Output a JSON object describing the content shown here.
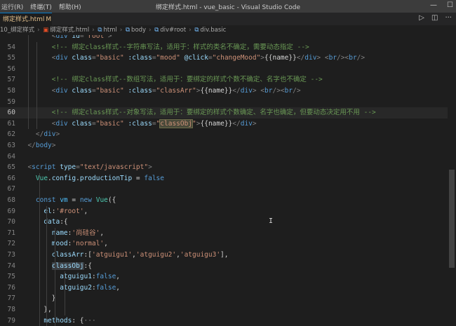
{
  "titlebar": {
    "menu": [
      "运行(R)",
      "终端(T)",
      "帮助(H)"
    ],
    "title": "绑定样式.html - vue_basic - Visual Studio Code"
  },
  "tab": {
    "label": "绑定样式.html",
    "modified": "M",
    "close": "×"
  },
  "breadcrumb": {
    "items": [
      "10_绑定样式",
      "绑定样式.html",
      "html",
      "body",
      "div#root",
      "div.basic"
    ]
  },
  "editor": {
    "current_line": 60,
    "lines": [
      {
        "n": "",
        "segs": [
          [
            "pun",
            "        <"
          ],
          [
            "tag",
            "div"
          ],
          [
            "att",
            " id"
          ],
          [
            "pun",
            "="
          ],
          [
            "str",
            "\"root\""
          ],
          [
            "pun",
            ">"
          ]
        ]
      },
      {
        "n": "54",
        "segs": [
          [
            "cmt",
            "        <!-- 绑定class样式--字符串写法，适用于：样式的类名不确定，需要动态指定 -->"
          ]
        ]
      },
      {
        "n": "55",
        "segs": [
          [
            "pun",
            "        <"
          ],
          [
            "tag",
            "div"
          ],
          [
            "att",
            " class"
          ],
          [
            "pun",
            "="
          ],
          [
            "str",
            "\"basic\""
          ],
          [
            "att",
            " :class"
          ],
          [
            "pun",
            "="
          ],
          [
            "str",
            "\"mood\""
          ],
          [
            "att",
            " @click"
          ],
          [
            "pun",
            "="
          ],
          [
            "str",
            "\"changeMood\""
          ],
          [
            "pun",
            ">"
          ],
          [
            "txt",
            "{{name}}"
          ],
          [
            "pun",
            "</"
          ],
          [
            "tag",
            "div"
          ],
          [
            "pun",
            "> <"
          ],
          [
            "tag",
            "br"
          ],
          [
            "pun",
            "/><"
          ],
          [
            "tag",
            "br"
          ],
          [
            "pun",
            "/>"
          ]
        ]
      },
      {
        "n": "56",
        "segs": []
      },
      {
        "n": "57",
        "segs": [
          [
            "cmt",
            "        <!-- 绑定class样式--数组写法，适用于：要绑定的样式个数不确定、名字也不确定 -->"
          ]
        ]
      },
      {
        "n": "58",
        "segs": [
          [
            "pun",
            "        <"
          ],
          [
            "tag",
            "div"
          ],
          [
            "att",
            " class"
          ],
          [
            "pun",
            "="
          ],
          [
            "str",
            "\"basic\""
          ],
          [
            "att",
            " :class"
          ],
          [
            "pun",
            "="
          ],
          [
            "str",
            "\"classArr\""
          ],
          [
            "pun",
            ">"
          ],
          [
            "txt",
            "{{name}}"
          ],
          [
            "pun",
            "</"
          ],
          [
            "tag",
            "div"
          ],
          [
            "pun",
            "> <"
          ],
          [
            "tag",
            "br"
          ],
          [
            "pun",
            "/><"
          ],
          [
            "tag",
            "br"
          ],
          [
            "pun",
            "/>"
          ]
        ]
      },
      {
        "n": "59",
        "segs": []
      },
      {
        "n": "60",
        "segs": [
          [
            "cmt",
            "        <!-- 绑定class样式--对象写法，适用于：要绑定的样式个数确定、名字也确定，但要动态决定用不用 -->"
          ]
        ]
      },
      {
        "n": "61",
        "segs": [
          [
            "pun",
            "        <"
          ],
          [
            "tag",
            "div"
          ],
          [
            "att",
            " class"
          ],
          [
            "pun",
            "="
          ],
          [
            "str",
            "\"basic\""
          ],
          [
            "att",
            " :class"
          ],
          [
            "pun",
            "="
          ],
          [
            "str",
            "\""
          ],
          [
            "hlstr",
            "classObj"
          ],
          [
            "str",
            "\""
          ],
          [
            "pun",
            ">"
          ],
          [
            "txt",
            "{{name}}"
          ],
          [
            "pun",
            "</"
          ],
          [
            "tag",
            "div"
          ],
          [
            "pun",
            ">"
          ]
        ]
      },
      {
        "n": "62",
        "segs": [
          [
            "pun",
            "    </"
          ],
          [
            "tag",
            "div"
          ],
          [
            "pun",
            ">"
          ]
        ]
      },
      {
        "n": "63",
        "segs": [
          [
            "pun",
            "  </"
          ],
          [
            "tag",
            "body"
          ],
          [
            "pun",
            ">"
          ]
        ]
      },
      {
        "n": "64",
        "segs": []
      },
      {
        "n": "65",
        "segs": [
          [
            "pun",
            "  <"
          ],
          [
            "tag",
            "script"
          ],
          [
            "att",
            " type"
          ],
          [
            "pun",
            "="
          ],
          [
            "str",
            "\"text/javascript\""
          ],
          [
            "pun",
            ">"
          ]
        ]
      },
      {
        "n": "66",
        "segs": [
          [
            "cls",
            "    Vue"
          ],
          [
            "txt",
            "."
          ],
          [
            "prop",
            "config"
          ],
          [
            "txt",
            "."
          ],
          [
            "prop",
            "productionTip"
          ],
          [
            "txt",
            " = "
          ],
          [
            "kw",
            "false"
          ]
        ]
      },
      {
        "n": "67",
        "segs": []
      },
      {
        "n": "68",
        "segs": [
          [
            "kw",
            "    const"
          ],
          [
            "var",
            " vm"
          ],
          [
            "txt",
            " = "
          ],
          [
            "kw",
            "new"
          ],
          [
            "cls",
            " Vue"
          ],
          [
            "txt",
            "({"
          ]
        ]
      },
      {
        "n": "69",
        "segs": [
          [
            "prop",
            "      el"
          ],
          [
            "txt",
            ":"
          ],
          [
            "str",
            "'#root'"
          ],
          [
            "txt",
            ","
          ]
        ]
      },
      {
        "n": "70",
        "segs": [
          [
            "prop",
            "      data"
          ],
          [
            "txt",
            ":{"
          ]
        ]
      },
      {
        "n": "71",
        "segs": [
          [
            "prop",
            "        name"
          ],
          [
            "txt",
            ":"
          ],
          [
            "str",
            "'尚硅谷'"
          ],
          [
            "txt",
            ","
          ]
        ]
      },
      {
        "n": "72",
        "segs": [
          [
            "prop",
            "        mood"
          ],
          [
            "txt",
            ":"
          ],
          [
            "str",
            "'normal'"
          ],
          [
            "txt",
            ","
          ]
        ]
      },
      {
        "n": "73",
        "segs": [
          [
            "prop",
            "        classArr"
          ],
          [
            "txt",
            ":["
          ],
          [
            "str",
            "'atguigu1'"
          ],
          [
            "txt",
            ","
          ],
          [
            "str",
            "'atguigu2'"
          ],
          [
            "txt",
            ","
          ],
          [
            "str",
            "'atguigu3'"
          ],
          [
            "txt",
            "],"
          ]
        ]
      },
      {
        "n": "74",
        "segs": [
          [
            "txt",
            "        "
          ],
          [
            "hlprop",
            "classObj"
          ],
          [
            "txt",
            ":{"
          ]
        ]
      },
      {
        "n": "75",
        "segs": [
          [
            "prop",
            "          atguigu1"
          ],
          [
            "txt",
            ":"
          ],
          [
            "kw",
            "false"
          ],
          [
            "txt",
            ","
          ]
        ]
      },
      {
        "n": "76",
        "segs": [
          [
            "prop",
            "          atguigu2"
          ],
          [
            "txt",
            ":"
          ],
          [
            "kw",
            "false"
          ],
          [
            "txt",
            ","
          ]
        ]
      },
      {
        "n": "77",
        "segs": [
          [
            "txt",
            "        }"
          ]
        ]
      },
      {
        "n": "78",
        "segs": [
          [
            "txt",
            "      },"
          ]
        ]
      },
      {
        "n": "79",
        "segs": [
          [
            "prop",
            "      methods"
          ],
          [
            "txt",
            ": {"
          ],
          [
            "pun",
            "···"
          ]
        ]
      },
      {
        "n": "",
        "segs": [
          [
            "txt",
            "    })"
          ]
        ]
      }
    ]
  }
}
